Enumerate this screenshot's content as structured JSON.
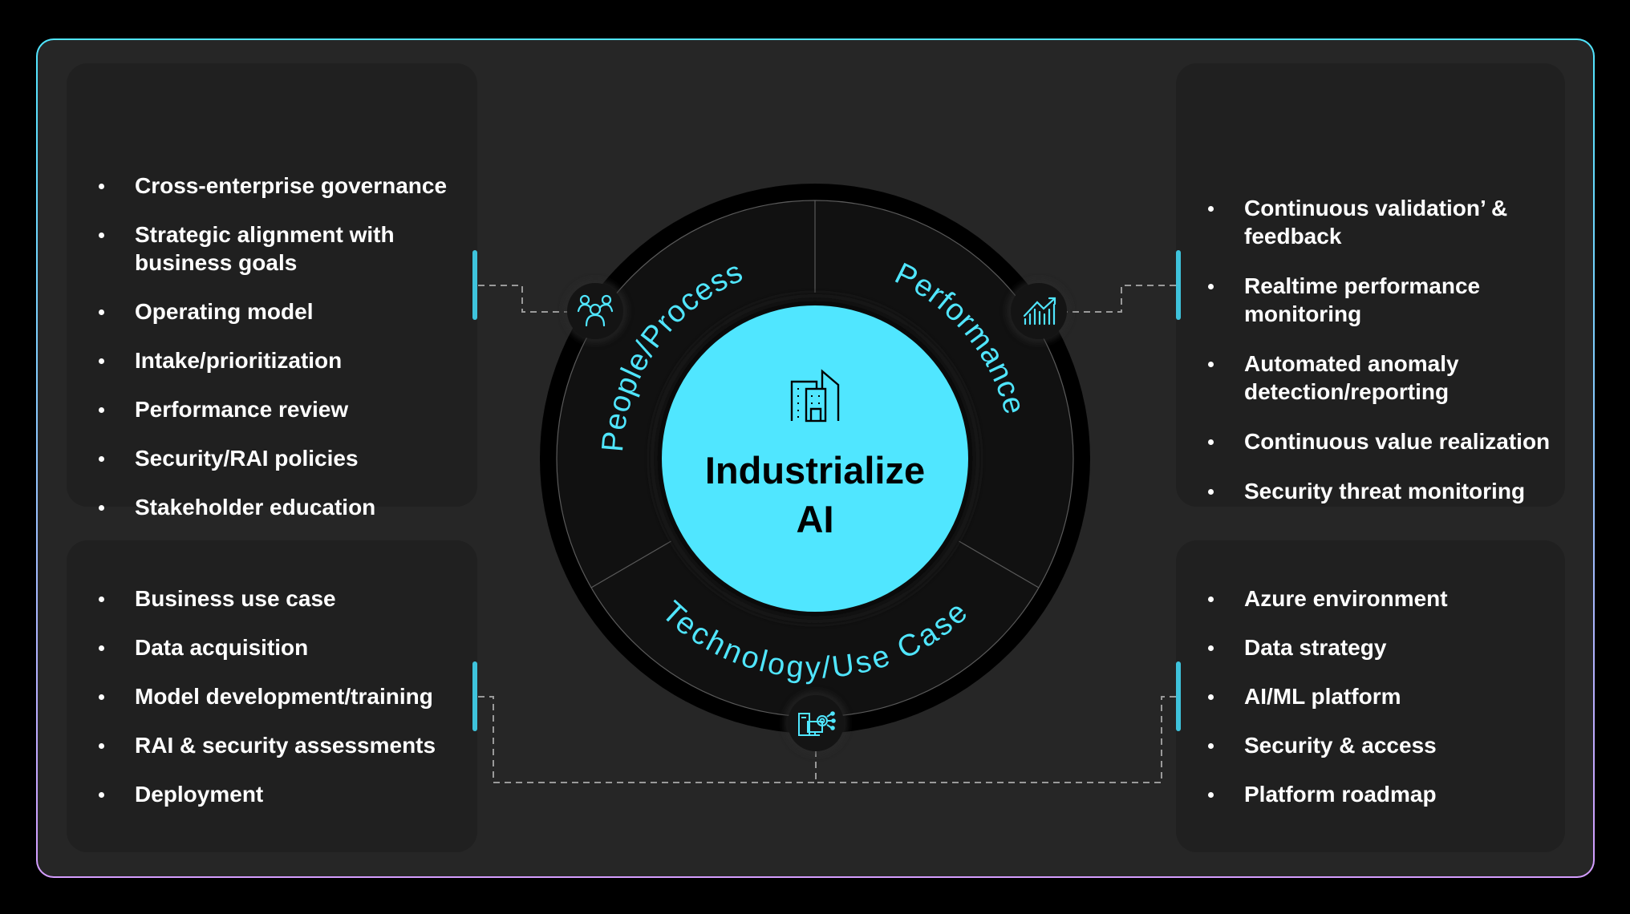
{
  "diagram": {
    "center": {
      "icon": "buildings-icon",
      "title_line1": "Industrialize",
      "title_line2": "AI"
    },
    "segments": [
      {
        "id": "people",
        "label": "People/Process",
        "icon": "people-group-icon"
      },
      {
        "id": "performance",
        "label": "Performance",
        "icon": "growth-chart-icon"
      },
      {
        "id": "technology",
        "label": "Technology/Use Case",
        "icon": "computer-gear-icon"
      }
    ],
    "colors": {
      "accent": "#50e6ff",
      "frame_top": "#50e6ff",
      "frame_bottom": "#d59dff",
      "background": "#262626",
      "card": "#202020"
    }
  },
  "cards": {
    "top_left": {
      "items": [
        "Cross-enterprise governance",
        "Strategic alignment with business goals",
        "Operating model",
        "Intake/prioritization",
        "Performance review",
        "Security/RAI policies",
        "Stakeholder education"
      ]
    },
    "top_right": {
      "items": [
        "Continuous validation’ & feedback",
        "Realtime performance monitoring",
        "Automated anomaly detection/reporting",
        "Continuous value realization",
        "Security threat monitoring"
      ]
    },
    "bottom_left": {
      "items": [
        "Business use case",
        "Data acquisition",
        "Model development/training",
        "RAI & security assessments",
        "Deployment"
      ]
    },
    "bottom_right": {
      "items": [
        "Azure environment",
        "Data strategy",
        "AI/ML platform",
        "Security & access",
        "Platform roadmap"
      ]
    }
  }
}
